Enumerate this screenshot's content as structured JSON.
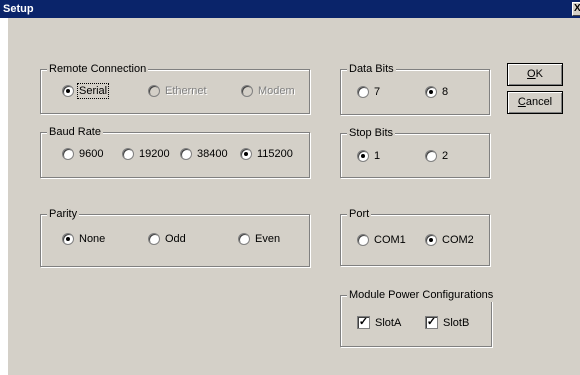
{
  "window": {
    "title": "Setup",
    "close_glyph": "X"
  },
  "buttons": {
    "ok": {
      "accel": "O",
      "rest": "K"
    },
    "cancel": {
      "accel": "C",
      "rest": "ancel"
    }
  },
  "remote_connection": {
    "label": "Remote Connection",
    "options": [
      {
        "label": "Serial",
        "checked": true,
        "enabled": true
      },
      {
        "label": "Ethernet",
        "checked": false,
        "enabled": false
      },
      {
        "label": "Modem",
        "checked": false,
        "enabled": false
      }
    ]
  },
  "baud_rate": {
    "label": "Baud Rate",
    "options": [
      {
        "label": "9600",
        "checked": false
      },
      {
        "label": "19200",
        "checked": false
      },
      {
        "label": "38400",
        "checked": false
      },
      {
        "label": "115200",
        "checked": true
      }
    ]
  },
  "parity": {
    "label": "Parity",
    "options": [
      {
        "label": "None",
        "checked": true
      },
      {
        "label": "Odd",
        "checked": false
      },
      {
        "label": "Even",
        "checked": false
      }
    ]
  },
  "data_bits": {
    "label": "Data Bits",
    "options": [
      {
        "label": "7",
        "checked": false
      },
      {
        "label": "8",
        "checked": true
      }
    ]
  },
  "stop_bits": {
    "label": "Stop Bits",
    "options": [
      {
        "label": "1",
        "checked": true
      },
      {
        "label": "2",
        "checked": false
      }
    ]
  },
  "port": {
    "label": "Port",
    "options": [
      {
        "label": "COM1",
        "checked": false
      },
      {
        "label": "COM2",
        "checked": true
      }
    ]
  },
  "module_power": {
    "label": "Module Power Configurations",
    "options": [
      {
        "label": "SlotA",
        "checked": true
      },
      {
        "label": "SlotB",
        "checked": true
      }
    ]
  },
  "checkmark_glyph": "✓"
}
